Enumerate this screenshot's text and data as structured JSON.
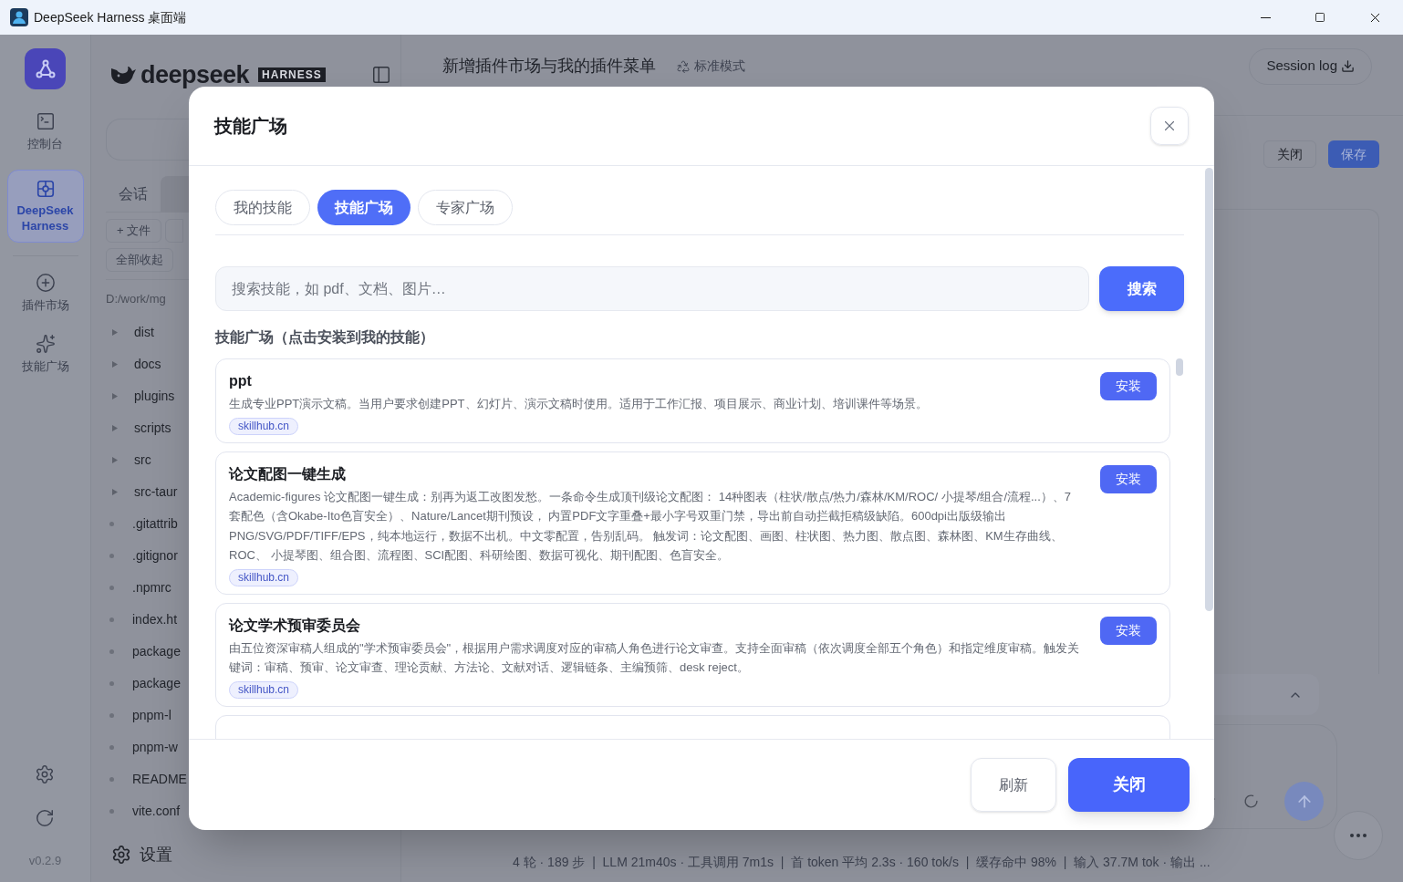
{
  "window": {
    "title": "DeepSeek Harness 桌面端"
  },
  "rail": {
    "items": [
      {
        "label": "控制台",
        "selected": false
      },
      {
        "label": "DeepSeek Harness",
        "selected": true
      },
      {
        "label": "插件市场",
        "selected": false
      },
      {
        "label": "技能广场",
        "selected": false
      }
    ],
    "version": "v0.2.9"
  },
  "file_panel": {
    "logo_text": "deepseek",
    "logo_badge": "HARNESS",
    "tabs": [
      {
        "label": "会话",
        "selected": false
      },
      {
        "selected": true
      }
    ],
    "buttons": [
      "+ 文件"
    ],
    "collapse_all": "全部收起",
    "path": "D:/work/mg",
    "files": [
      {
        "name": "dist",
        "kind": "folder"
      },
      {
        "name": "docs",
        "kind": "folder"
      },
      {
        "name": "plugins",
        "kind": "folder"
      },
      {
        "name": "scripts",
        "kind": "folder"
      },
      {
        "name": "src",
        "kind": "folder"
      },
      {
        "name": "src-taur",
        "kind": "folder"
      },
      {
        "name": ".gitattrib",
        "kind": "file"
      },
      {
        "name": ".gitignor",
        "kind": "file"
      },
      {
        "name": ".npmrc",
        "kind": "file"
      },
      {
        "name": "index.ht",
        "kind": "file"
      },
      {
        "name": "package",
        "kind": "file"
      },
      {
        "name": "package",
        "kind": "file"
      },
      {
        "name": "pnpm-l",
        "kind": "file"
      },
      {
        "name": "pnpm-w",
        "kind": "file"
      },
      {
        "name": "README",
        "kind": "file"
      },
      {
        "name": "vite.conf",
        "kind": "file"
      }
    ],
    "settings": "设置"
  },
  "main": {
    "title": "新增插件市场与我的插件菜单",
    "mode": "标准模式",
    "session_log": "Session log",
    "toolbar": [
      "关闭",
      "保存"
    ],
    "status_bar": "4 轮 · 189 步  |  LLM 21m40s · 工具调用 7m1s  |  首 token 平均 2.3s · 160 tok/s  |  缓存命中 98%  |  输入 37.7M tok · 输出 ..."
  },
  "dialog": {
    "title": "技能广场",
    "tabs": [
      {
        "label": "我的技能",
        "selected": false
      },
      {
        "label": "技能广场",
        "selected": true
      },
      {
        "label": "专家广场",
        "selected": false
      }
    ],
    "search": {
      "placeholder": "搜索技能，如 pdf、文档、图片…",
      "button": "搜索"
    },
    "section_title": "技能广场（点击安装到我的技能）",
    "skills": [
      {
        "name": "ppt",
        "description": "生成专业PPT演示文稿。当用户要求创建PPT、幻灯片、演示文稿时使用。适用于工作汇报、项目展示、商业计划、培训课件等场景。",
        "source": "skillhub.cn",
        "action": "安装"
      },
      {
        "name": "论文配图一键生成",
        "description": "Academic-figures 论文配图一键生成：别再为返工改图发愁。一条命令生成顶刊级论文配图： 14种图表（柱状/散点/热力/森林/KM/ROC/ 小提琴/组合/流程...）、7套配色（含Okabe-Ito色盲安全）、Nature/Lancet期刊预设， 内置PDF文字重叠+最小字号双重门禁，导出前自动拦截拒稿级缺陷。600dpi出版级输出 PNG/SVG/PDF/TIFF/EPS，纯本地运行，数据不出机。中文零配置，告别乱码。 触发词：论文配图、画图、柱状图、热力图、散点图、森林图、KM生存曲线、ROC、 小提琴图、组合图、流程图、SCI配图、科研绘图、数据可视化、期刊配图、色盲安全。",
        "source": "skillhub.cn",
        "action": "安装"
      },
      {
        "name": "论文学术预审委员会",
        "description": "由五位资深审稿人组成的\"学术预审委员会\"，根据用户需求调度对应的审稿人角色进行论文审查。支持全面审稿（依次调度全部五个角色）和指定维度审稿。触发关键词：审稿、预审、论文审查、理论贡献、方法论、文献对话、逻辑链条、主编预筛、desk reject。",
        "source": "skillhub.cn",
        "action": "安装"
      }
    ],
    "footer": {
      "refresh": "刷新",
      "close": "关闭"
    }
  }
}
